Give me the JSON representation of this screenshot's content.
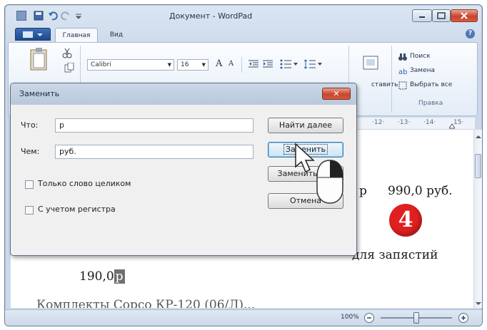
{
  "window": {
    "title": "Документ - WordPad",
    "tabs": [
      "Главная",
      "Вид"
    ],
    "active_tab": "Главная"
  },
  "ribbon": {
    "font_name": "Calibri",
    "font_size": "16",
    "grow_font": "A",
    "shrink_font": "A",
    "edit_find": "Поиск",
    "edit_replace": "Замена",
    "edit_select_all": "Выбрать все",
    "edit_group": "Правка",
    "insert_partial": "ставить"
  },
  "ruler": {
    "ticks": [
      "·12·",
      "·13·",
      "·14·",
      "15·"
    ]
  },
  "document": {
    "price_1": "990,0 руб.",
    "fragment_p": "р",
    "text_fragment": "для запястий",
    "price_2_prefix": "190,0",
    "price_2_highlight": "р",
    "bottom_partial": "Комплекты Сорсо КР-120 (06/Л)...",
    "step_badge": "4"
  },
  "status": {
    "zoom": "100%",
    "zoom_level": 0.5
  },
  "dialog": {
    "title": "Заменить",
    "close_label": "✕",
    "find_label": "Что:",
    "find_value": "р",
    "replace_label": "Чем:",
    "replace_value": "руб.",
    "whole_word_label": "Только слово целиком",
    "match_case_label": "С учетом регистра",
    "find_next_button": "Найти далее",
    "replace_button": "Заменить",
    "replace_all_button": "Заменить все",
    "cancel_button": "Отмена"
  },
  "colors": {
    "badge": "#e02020",
    "dialog_title_bg": "#bccadd",
    "highlight": "#6f6f6f"
  }
}
